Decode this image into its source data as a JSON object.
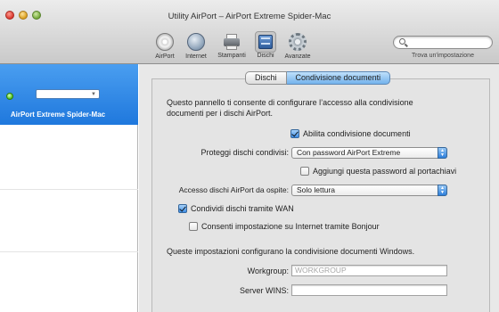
{
  "window": {
    "title": "Utility AirPort – AirPort Extreme Spider-Mac"
  },
  "toolbar": {
    "items": [
      {
        "label": "AirPort",
        "icon": "airport-icon"
      },
      {
        "label": "Internet",
        "icon": "globe-icon"
      },
      {
        "label": "Stampanti",
        "icon": "printer-icon"
      },
      {
        "label": "Dischi",
        "icon": "disk-icon",
        "selected": true
      },
      {
        "label": "Avanzate",
        "icon": "gear-icon"
      }
    ],
    "search": {
      "placeholder": "",
      "caption": "Trova un'impostazione"
    }
  },
  "sidebar": {
    "items": [
      {
        "label": "AirPort Extreme Spider-Mac",
        "status_color": "#4cc21b",
        "selected": true
      }
    ]
  },
  "tabs": [
    {
      "label": "Dischi",
      "active": false
    },
    {
      "label": "Condivisione documenti",
      "active": true
    }
  ],
  "panel": {
    "intro": "Questo pannello ti consente di configurare l’accesso alla condivisione documenti per i dischi AirPort.",
    "enable_sharing": {
      "label": "Abilita condivisione documenti",
      "checked": true
    },
    "protect_disks": {
      "label": "Proteggi dischi condivisi:",
      "value": "Con password AirPort Extreme"
    },
    "add_to_keychain": {
      "label": "Aggiungi questa password al portachiavi",
      "checked": false
    },
    "guest_access": {
      "label": "Accesso dischi AirPort da ospite:",
      "value": "Solo lettura"
    },
    "share_wan": {
      "label": "Condividi dischi tramite WAN",
      "checked": true
    },
    "bonjour": {
      "label": "Consenti impostazione su Internet tramite Bonjour",
      "checked": false
    },
    "windows_note": "Queste impostazioni configurano la condivisione documenti Windows.",
    "workgroup": {
      "label": "Workgroup:",
      "value": "",
      "placeholder": "WORKGROUP"
    },
    "wins_server": {
      "label": "Server WINS:",
      "value": ""
    }
  },
  "colors": {
    "sidebar_selection": "#2a82e4",
    "accent": "#3d8de6"
  }
}
